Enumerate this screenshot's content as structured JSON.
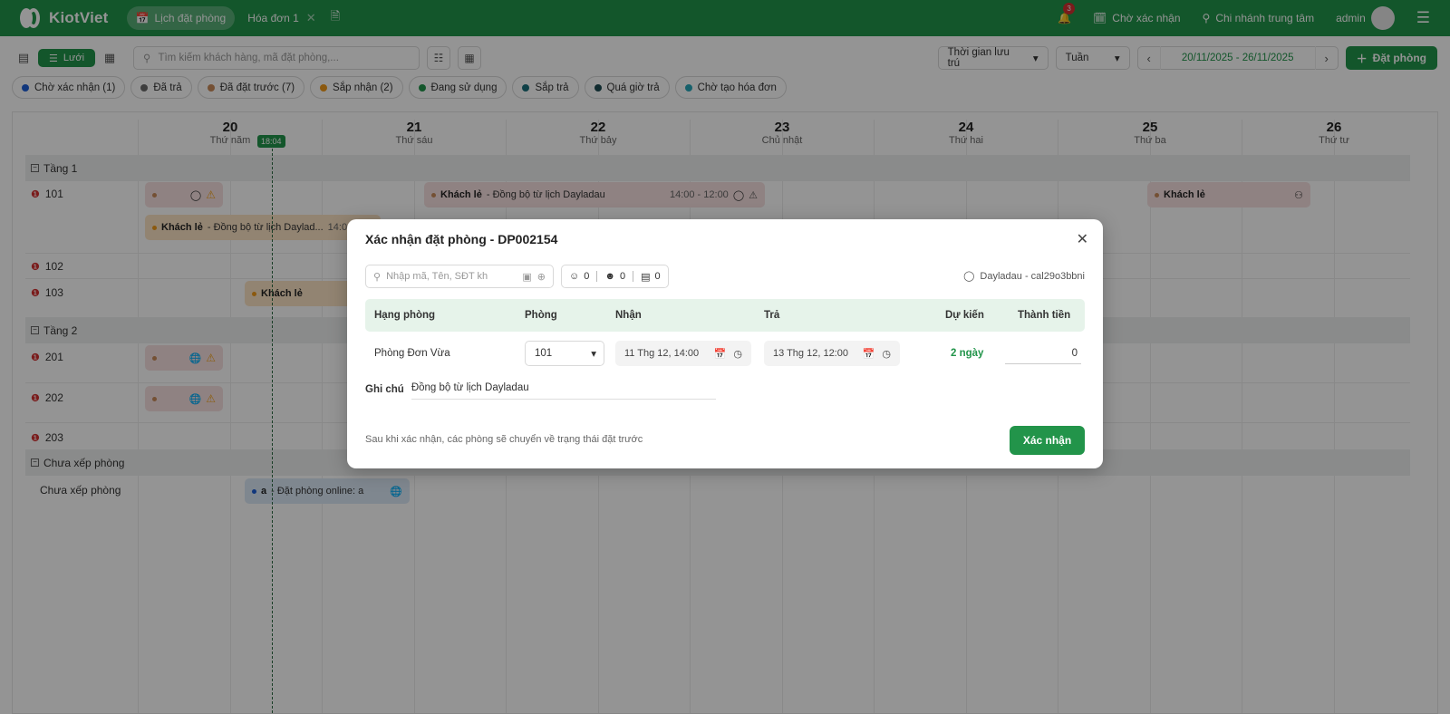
{
  "app": {
    "brand": "KiotViet"
  },
  "header": {
    "tabs": [
      {
        "label": "Lịch đặt phòng",
        "active": true
      },
      {
        "label": "Hóa đơn 1",
        "active": false
      }
    ],
    "notification_count": "3",
    "pending_label": "Chờ xác nhận",
    "branch_label": "Chi nhánh trung tâm",
    "user_label": "admin"
  },
  "toolbar": {
    "grid_label": "Lưới",
    "search_placeholder": "Tìm kiếm khách hàng, mã đặt phòng,...",
    "stay_time_label": "Thời gian lưu trú",
    "period_label": "Tuần",
    "date_range": "20/11/2025 - 26/11/2025",
    "book_label": "Đặt phòng"
  },
  "filters": [
    {
      "label": "Chờ xác nhận (1)",
      "color": "#1e5fd6"
    },
    {
      "label": "Đã trả",
      "color": "#6b6b6b"
    },
    {
      "label": "Đã đặt trước (7)",
      "color": "#c98b5a"
    },
    {
      "label": "Sắp nhận (2)",
      "color": "#f09a1a"
    },
    {
      "label": "Đang sử dụng",
      "color": "#22944a"
    },
    {
      "label": "Sắp trả",
      "color": "#1a6f7a"
    },
    {
      "label": "Quá giờ trả",
      "color": "#1c4b52"
    },
    {
      "label": "Chờ tạo hóa đơn",
      "color": "#26a5b8"
    }
  ],
  "calendar": {
    "days": [
      {
        "num": "20",
        "weekday": "Thứ năm"
      },
      {
        "num": "21",
        "weekday": "Thứ sáu"
      },
      {
        "num": "22",
        "weekday": "Thứ bảy"
      },
      {
        "num": "23",
        "weekday": "Chủ nhật"
      },
      {
        "num": "24",
        "weekday": "Thứ hai"
      },
      {
        "num": "25",
        "weekday": "Thứ ba"
      },
      {
        "num": "26",
        "weekday": "Thứ tư"
      }
    ],
    "now_time": "18:04",
    "floors": [
      "Tầng 1",
      "Tầng 2",
      "Chưa xếp phòng"
    ],
    "rooms": [
      "101",
      "102",
      "103",
      "201",
      "202",
      "203",
      "Chưa xếp phòng"
    ],
    "bookings": {
      "b1_name": "Khách lẻ",
      "b1_desc": " - Đồng bộ từ lịch Dayladau",
      "b1_time": "14:00 - 12:00",
      "b2_name": "Khách lẻ",
      "b3_name": "Khách lẻ",
      "b3_desc": " - Đồng bộ từ lịch Daylad...",
      "b3_time": "14:00",
      "b4_name": "Khách lẻ",
      "b5_name": "a",
      "b5_desc": " - Đặt phòng online: a"
    }
  },
  "modal": {
    "title": "Xác nhận đặt phòng - DP002154",
    "search_placeholder": "Nhập mã, Tên, SĐT kh",
    "adults": "0",
    "children": "0",
    "ids": "0",
    "source": "Dayladau - cal29o3bbni",
    "columns": [
      "Hạng phòng",
      "Phòng",
      "Nhận",
      "Trả",
      "Dự kiến",
      "Thành tiền"
    ],
    "row": {
      "room_type": "Phòng Đơn Vừa",
      "room": "101",
      "checkin": "11 Thg 12, 14:00",
      "checkout": "13 Thg 12, 12:00",
      "duration": "2 ngày",
      "amount": "0"
    },
    "note_label": "Ghi chú",
    "note_value": "Đồng bộ từ lịch Dayladau",
    "footer_note": "Sau khi xác nhận, các phòng sẽ chuyển về trạng thái đặt trước",
    "confirm_label": "Xác nhận"
  }
}
